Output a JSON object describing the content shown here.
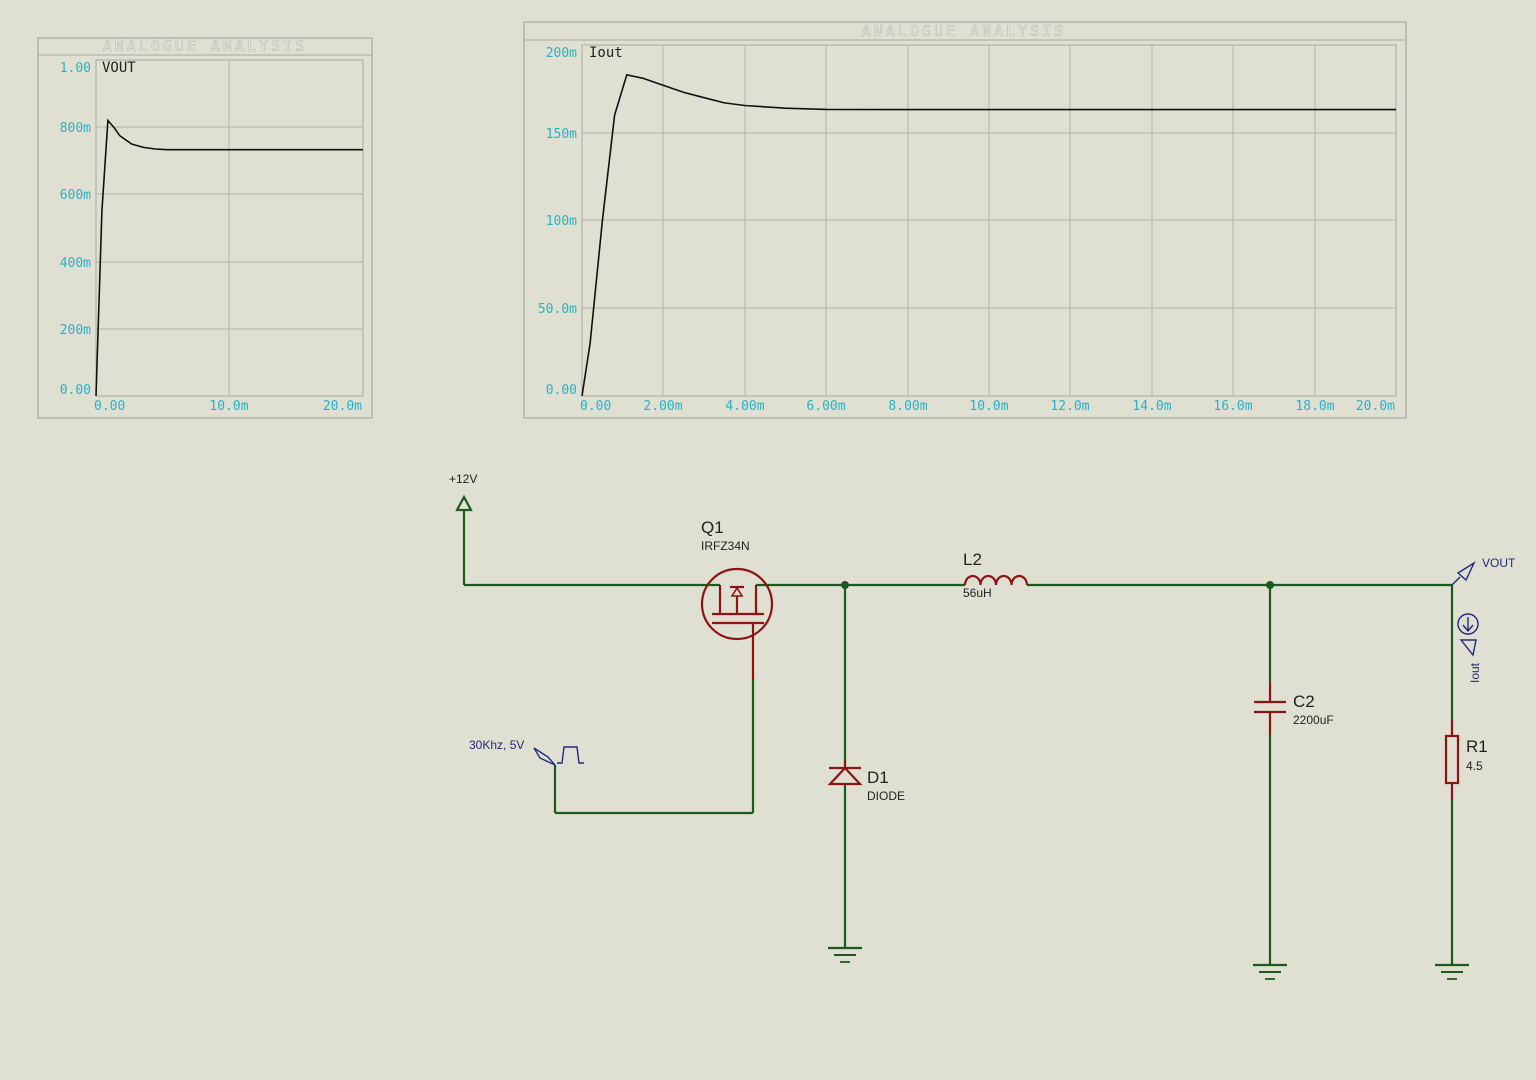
{
  "graphs": [
    {
      "id": "vout",
      "title": "ANALOGUE ANALYSIS",
      "trace_label": "VOUT",
      "y_ticks": [
        "0.00",
        "200m",
        "400m",
        "600m",
        "800m",
        "1.00"
      ],
      "x_ticks": [
        "0.00",
        "10.0m",
        "20.0m"
      ]
    },
    {
      "id": "iout",
      "title": "ANALOGUE ANALYSIS",
      "trace_label": "Iout",
      "y_ticks": [
        "0.00",
        "50.0m",
        "100m",
        "150m",
        "200m"
      ],
      "x_ticks": [
        "0.00",
        "2.00m",
        "4.00m",
        "6.00m",
        "8.00m",
        "10.0m",
        "12.0m",
        "14.0m",
        "16.0m",
        "18.0m",
        "20.0m"
      ]
    }
  ],
  "chart_data": [
    {
      "type": "line",
      "title": "ANALOGUE ANALYSIS",
      "xlabel": "",
      "ylabel": "",
      "xlim": [
        0,
        0.0225
      ],
      "ylim": [
        0,
        1.0
      ],
      "grid": true,
      "series": [
        {
          "name": "VOUT",
          "x": [
            0,
            0.0005,
            0.001,
            0.0015,
            0.002,
            0.003,
            0.004,
            0.005,
            0.006,
            0.008,
            0.01,
            0.015,
            0.02,
            0.0225
          ],
          "y": [
            0,
            0.55,
            0.82,
            0.8,
            0.775,
            0.75,
            0.74,
            0.735,
            0.733,
            0.733,
            0.733,
            0.733,
            0.733,
            0.733
          ]
        }
      ]
    },
    {
      "type": "line",
      "title": "ANALOGUE ANALYSIS",
      "xlabel": "",
      "ylabel": "",
      "xlim": [
        0,
        0.02
      ],
      "ylim": [
        0,
        0.2
      ],
      "grid": true,
      "series": [
        {
          "name": "Iout",
          "x": [
            0,
            0.0002,
            0.0005,
            0.0008,
            0.0011,
            0.0015,
            0.002,
            0.0025,
            0.003,
            0.0035,
            0.004,
            0.005,
            0.006,
            0.008,
            0.01,
            0.015,
            0.02
          ],
          "y": [
            0,
            0.03,
            0.1,
            0.16,
            0.183,
            0.181,
            0.177,
            0.173,
            0.17,
            0.167,
            0.1655,
            0.164,
            0.1633,
            0.1632,
            0.1632,
            0.1632,
            0.1632
          ]
        }
      ]
    }
  ],
  "schematic": {
    "supply_label": "+12V",
    "q1": {
      "ref": "Q1",
      "value": "IRFZ34N"
    },
    "l2": {
      "ref": "L2",
      "value": "56uH"
    },
    "c2": {
      "ref": "C2",
      "value": "2200uF"
    },
    "d1": {
      "ref": "D1",
      "value": "DIODE"
    },
    "r1": {
      "ref": "R1",
      "value": "4.5"
    },
    "pulse_source": "30Khz, 5V",
    "vout_probe": "VOUT",
    "iout_probe": "Iout"
  },
  "colors": {
    "background": "#dfdfd2",
    "wire": "#1d5a1d",
    "component": "#8e1414",
    "tick_text": "#27b3c6",
    "probe": "#1f2a80"
  }
}
